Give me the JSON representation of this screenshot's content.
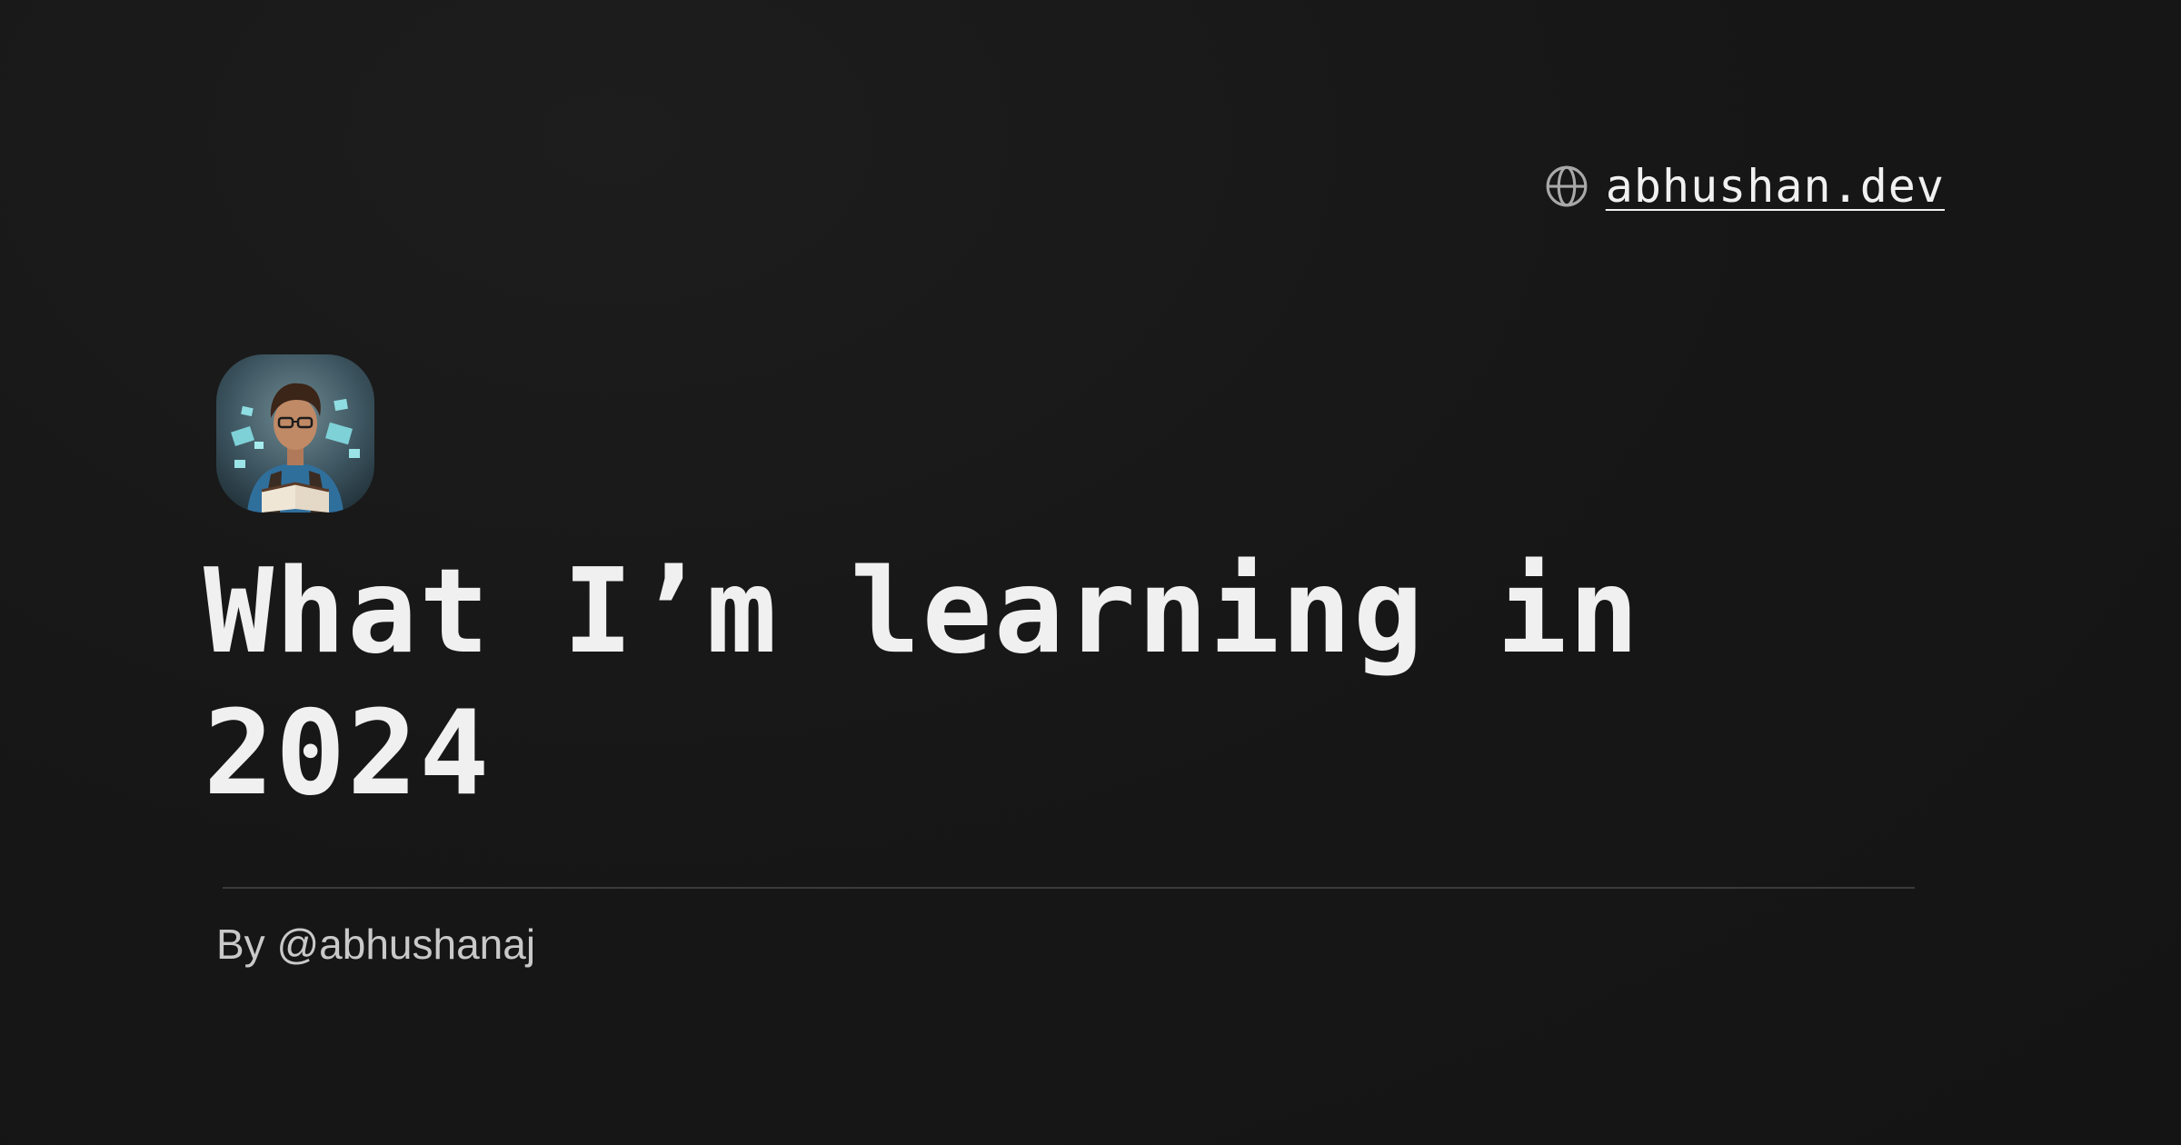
{
  "header": {
    "site_link": {
      "icon": "globe-icon",
      "label": "abhushan.dev"
    }
  },
  "post": {
    "avatar": "author-avatar",
    "title": "What I’m learning in 2024",
    "byline": "By @abhushanaj"
  },
  "colors": {
    "background": "#161616",
    "title_text": "#f0f0f0",
    "byline_text": "#c9c9c9",
    "divider": "#3b3b3b"
  }
}
